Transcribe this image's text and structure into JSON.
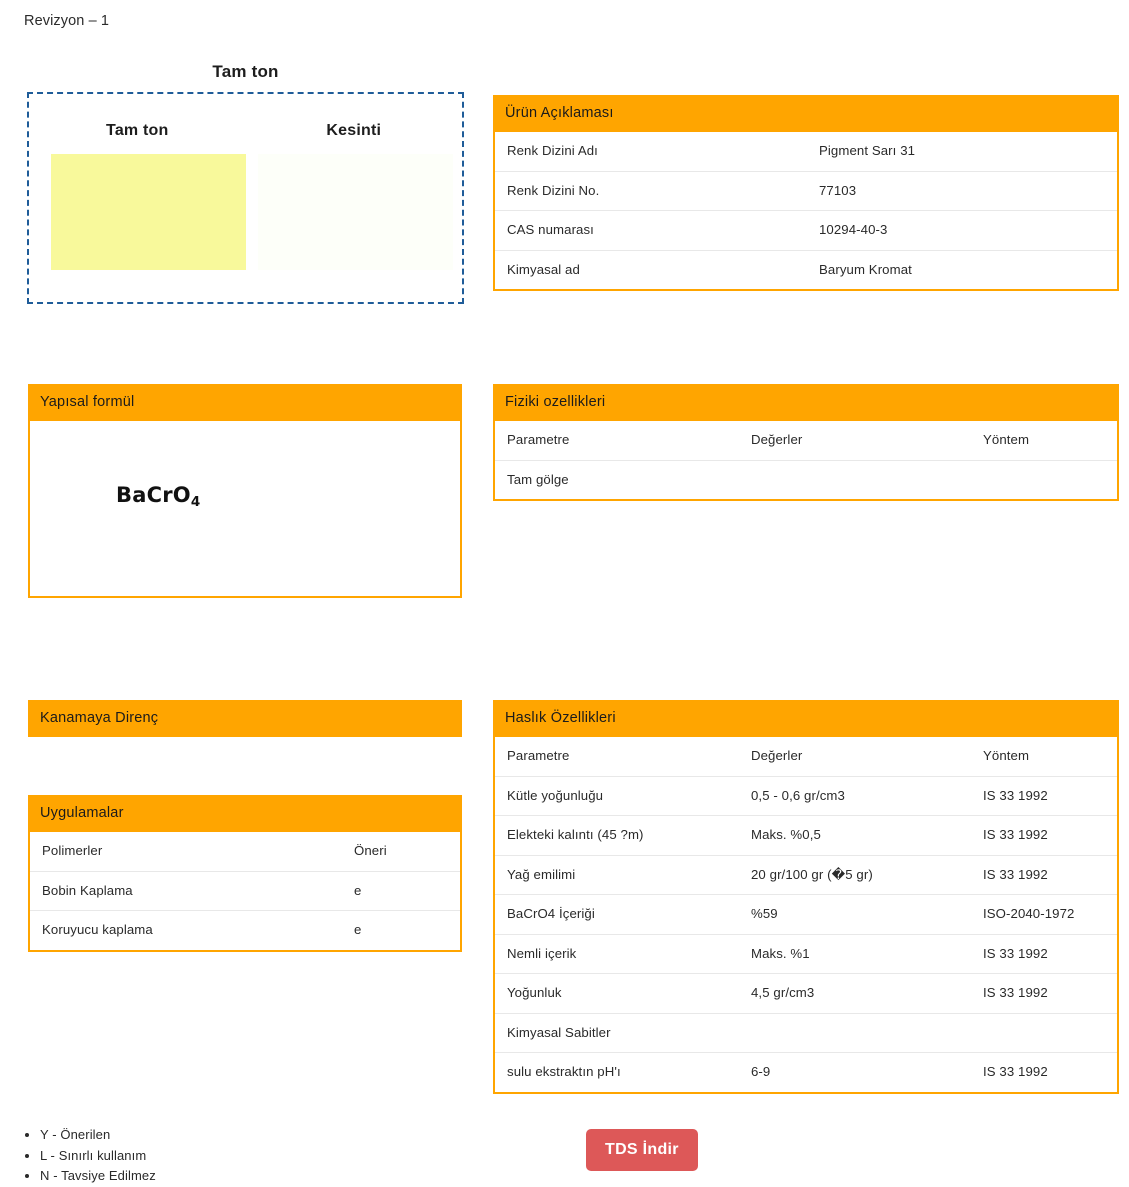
{
  "revision": "Revizyon – 1",
  "shade": {
    "title": "Tam ton",
    "columns": [
      {
        "label": "Tam ton",
        "color": "#f8f99b"
      },
      {
        "label": "Kesinti",
        "color": "#fdfff9"
      }
    ],
    "border_color": "#1f5c99"
  },
  "theme": {
    "accent": "#ffa500",
    "button": "#dd5858",
    "row_divider": "#e8e8e8"
  },
  "product_description": {
    "title": "Ürün Açıklaması",
    "rows": [
      {
        "label": "Renk Dizini Adı",
        "value": "Pigment Sarı 31"
      },
      {
        "label": "Renk Dizini No.",
        "value": "77103"
      },
      {
        "label": "CAS numarası",
        "value": "10294-40-3"
      },
      {
        "label": "Kimyasal ad",
        "value": "Baryum Kromat"
      }
    ]
  },
  "structural_formula": {
    "title": "Yapısal formül",
    "formula_main": "BaCrO",
    "formula_sub": "4"
  },
  "physical_properties": {
    "title": "Fiziki ozellikleri",
    "headers": {
      "parameter": "Parametre",
      "values": "Değerler",
      "method": "Yöntem"
    },
    "rows": [
      {
        "parameter": "Tam gölge",
        "value": "",
        "method": ""
      }
    ]
  },
  "bleed_resistance": {
    "title": "Kanamaya Direnç"
  },
  "applications": {
    "title": "Uygulamalar",
    "headers": {
      "parameter": "Polimerler",
      "value": "Öneri"
    },
    "rows": [
      {
        "parameter": "Bobin Kaplama",
        "value": "e"
      },
      {
        "parameter": "Koruyucu kaplama",
        "value": "e"
      }
    ]
  },
  "fastness_properties": {
    "title": "Haslık Özellikleri",
    "headers": {
      "parameter": "Parametre",
      "values": "Değerler",
      "method": "Yöntem"
    },
    "rows": [
      {
        "parameter": "Kütle yoğunluğu",
        "value": "0,5 - 0,6 gr/cm3",
        "method": "IS 33 1992"
      },
      {
        "parameter": "Elekteki kalıntı (45 ?m)",
        "value": "Maks. %0,5",
        "method": "IS 33 1992"
      },
      {
        "parameter": "Yağ emilimi",
        "value": "20 gr/100 gr (�5 gr)",
        "method": "IS 33 1992"
      },
      {
        "parameter": "BaCrO4 İçeriği",
        "value": "%59",
        "method": "ISO-2040-1972"
      },
      {
        "parameter": "Nemli içerik",
        "value": "Maks. %1",
        "method": "IS 33 1992"
      },
      {
        "parameter": "Yoğunluk",
        "value": "4,5 gr/cm3",
        "method": "IS 33 1992"
      },
      {
        "parameter": "Kimyasal Sabitler",
        "value": "",
        "method": ""
      },
      {
        "parameter": "sulu ekstraktın pH'ı",
        "value": "6-9",
        "method": "IS 33 1992"
      }
    ]
  },
  "legend": [
    "Y - Önerilen",
    "L - Sınırlı kullanım",
    "N - Tavsiye Edilmez"
  ],
  "download_button": {
    "label": "TDS İndir"
  }
}
